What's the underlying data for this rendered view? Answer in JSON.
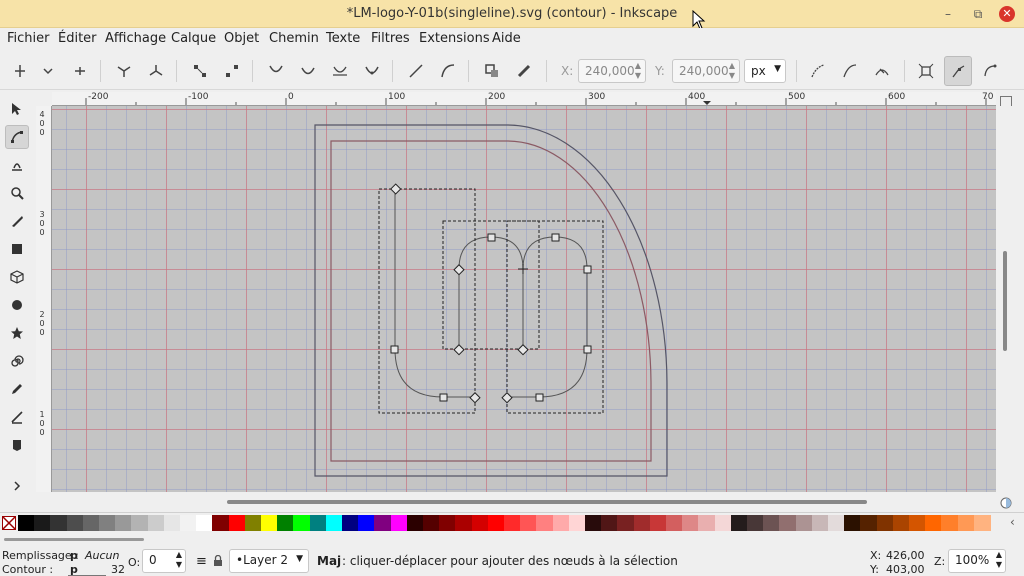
{
  "window": {
    "title": "*LM-logo-Y-01b(singleline).svg (contour) - Inkscape",
    "minimize": "–",
    "restore": "⧉",
    "close": "✕"
  },
  "menu": [
    "Fichier",
    "Éditer",
    "Affichage",
    "Calque",
    "Objet",
    "Chemin",
    "Texte",
    "Filtres",
    "Extensions",
    "Aide"
  ],
  "toolbar": {
    "x_label": "X:",
    "x_value": "240,000",
    "y_label": "Y:",
    "y_value": "240,000",
    "unit": "px"
  },
  "rulers": {
    "horizontal": [
      "-200",
      "-100",
      "0",
      "100",
      "200",
      "300",
      "400",
      "500",
      "600",
      "70"
    ],
    "vertical": [
      [
        "4",
        "0",
        "0"
      ],
      [
        "3",
        "0",
        "0"
      ],
      [
        "2",
        "0",
        "0"
      ],
      [
        "1",
        "0",
        "0"
      ]
    ]
  },
  "palette_colors": [
    "#000000",
    "#1a1a1a",
    "#333333",
    "#4d4d4d",
    "#666666",
    "#808080",
    "#999999",
    "#b3b3b3",
    "#cccccc",
    "#e6e6e6",
    "#f2f2f2",
    "#ffffff",
    "#800000",
    "#ff0000",
    "#808000",
    "#ffff00",
    "#008000",
    "#00ff00",
    "#008080",
    "#00ffff",
    "#000080",
    "#0000ff",
    "#800080",
    "#ff00ff",
    "#2b0000",
    "#550000",
    "#800000",
    "#aa0000",
    "#d40000",
    "#ff0000",
    "#ff2a2a",
    "#ff5555",
    "#ff8080",
    "#ffaaaa",
    "#ffd5d5",
    "#280b0b",
    "#501616",
    "#782121",
    "#a02c2c",
    "#c83737",
    "#d35f5f",
    "#de8787",
    "#e9afaf",
    "#f4d7d7",
    "#241c1c",
    "#483737",
    "#6c5353",
    "#916f6f",
    "#ac9393",
    "#c8b7b7",
    "#e3dbdb",
    "#2b1100",
    "#552200",
    "#803300",
    "#aa4400",
    "#d45500",
    "#ff6600",
    "#ff7f2a",
    "#ff9955",
    "#ffb380"
  ],
  "status": {
    "fill_label": "Remplissage :",
    "fill_short": "p",
    "fill_value": "Aucun",
    "stroke_label": "Contour :",
    "stroke_short": "p",
    "stroke_width": "32",
    "opacity_label": "O:",
    "opacity_value": "0",
    "layer": "•Layer 2",
    "message_bold": "Maj",
    "message": " : cliquer-déplacer pour ajouter des nœuds à la sélection",
    "cursor_x_label": "X:",
    "cursor_x": "426,00",
    "cursor_y_label": "Y:",
    "cursor_y": "403,00",
    "zoom_label": "Z:",
    "zoom": "100%"
  }
}
